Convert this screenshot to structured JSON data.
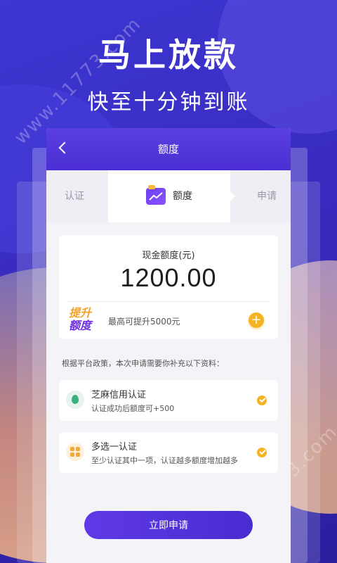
{
  "hero": {
    "title": "马上放款",
    "subtitle": "快至十分钟到账"
  },
  "watermark": "www.11773.com",
  "phone": {
    "header_title": "额度",
    "steps": {
      "left": "认证",
      "active": "额度",
      "right": "申请"
    },
    "amount_card": {
      "label": "现金额度(元)",
      "value": "1200.00",
      "raise_tag_line1": "提升",
      "raise_tag_line2": "额度",
      "raise_text": "最高可提升5000元",
      "plus": "+"
    },
    "notice": "根据平台政策，本次申请需要你补充以下资料：",
    "items": [
      {
        "title": "芝麻信用认证",
        "desc": "认证成功后额度可+500",
        "icon": "sesame-icon"
      },
      {
        "title": "多选一认证",
        "desc": "至少认证其中一项，认证越多额度增加越多",
        "icon": "apps-icon"
      }
    ],
    "apply_button": "立即申请"
  },
  "colors": {
    "brand": "#4c2fd4",
    "accent": "#f5b324"
  }
}
